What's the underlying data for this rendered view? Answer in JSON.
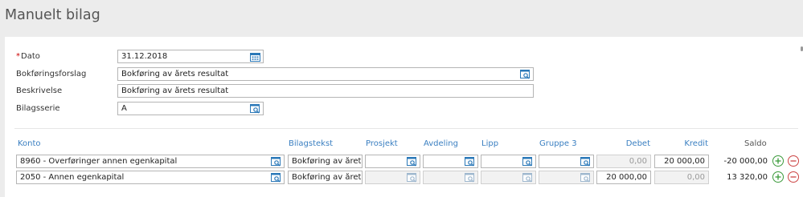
{
  "page": {
    "title": "Manuelt bilag"
  },
  "form": {
    "dato": {
      "label": "Dato",
      "required_mark": "*",
      "value": "31.12.2018"
    },
    "bokforingsforslag": {
      "label": "Bokføringsforslag",
      "value": "Bokføring av årets resultat"
    },
    "beskrivelse": {
      "label": "Beskrivelse",
      "value": "Bokføring av årets resultat"
    },
    "bilagsserie": {
      "label": "Bilagsserie",
      "value": "A"
    }
  },
  "table": {
    "headers": {
      "konto": "Konto",
      "bilagstekst": "Bilagstekst",
      "prosjekt": "Prosjekt",
      "avdeling": "Avdeling",
      "lipp": "Lipp",
      "gruppe3": "Gruppe 3",
      "debet": "Debet",
      "kredit": "Kredit",
      "saldo": "Saldo"
    },
    "rows": [
      {
        "konto": "8960 - Overføringer annen egenkapital",
        "bilagstekst": "Bokføring av årets r",
        "prosjekt": "",
        "avdeling": "",
        "lipp": "",
        "gruppe3": "",
        "debet": "0,00",
        "kredit": "20 000,00",
        "saldo": "-20 000,00"
      },
      {
        "konto": "2050 - Annen egenkapital",
        "bilagstekst": "Bokføring av årets r",
        "prosjekt": "",
        "avdeling": "",
        "lipp": "",
        "gruppe3": "",
        "debet": "20 000,00",
        "kredit": "0,00",
        "saldo": "13 320,00"
      }
    ]
  },
  "icons": {
    "calendar": "calendar-icon",
    "lookup": "lookup-icon",
    "add": "plus-circle-icon",
    "remove": "minus-circle-icon"
  },
  "colors": {
    "link_header": "#3a7fc1",
    "add": "#3a9a3a",
    "remove": "#cc4444",
    "icon": "#2a78b8"
  }
}
